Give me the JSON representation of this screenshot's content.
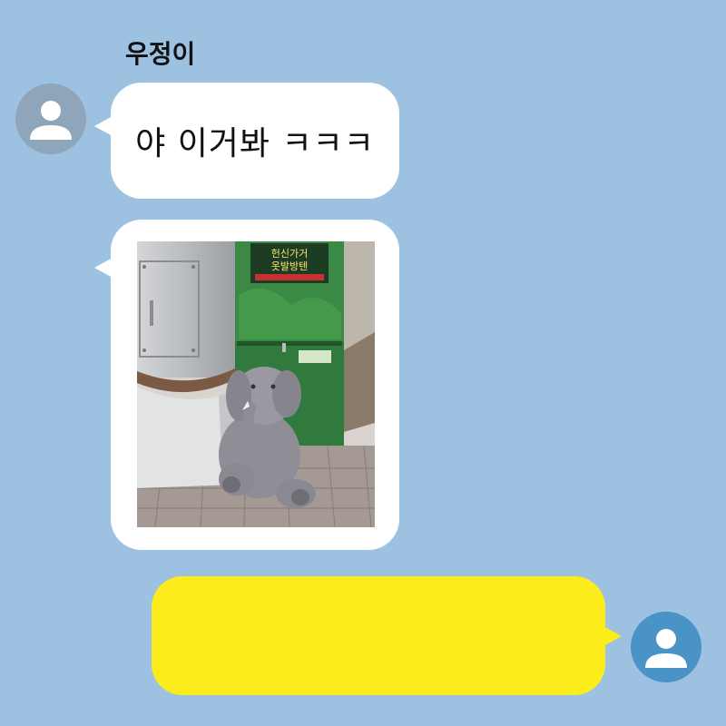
{
  "chat": {
    "sender_name": "우정이",
    "messages": [
      {
        "type": "text",
        "text": "야 이거봐 ㅋㅋㅋ"
      },
      {
        "type": "image",
        "image": "elephant-plush-photo"
      },
      {
        "type": "text",
        "text": ""
      }
    ]
  },
  "photo": {
    "sign_line_1": "헌신가거",
    "sign_line_2": "옷발방텐"
  },
  "colors": {
    "background": "#9cc1e1",
    "incoming_bubble": "#ffffff",
    "outgoing_bubble": "#fdec1b",
    "avatar_left": "#8fa6ba",
    "avatar_right": "#4a93c7"
  },
  "icons": {
    "avatar": "person-icon"
  }
}
